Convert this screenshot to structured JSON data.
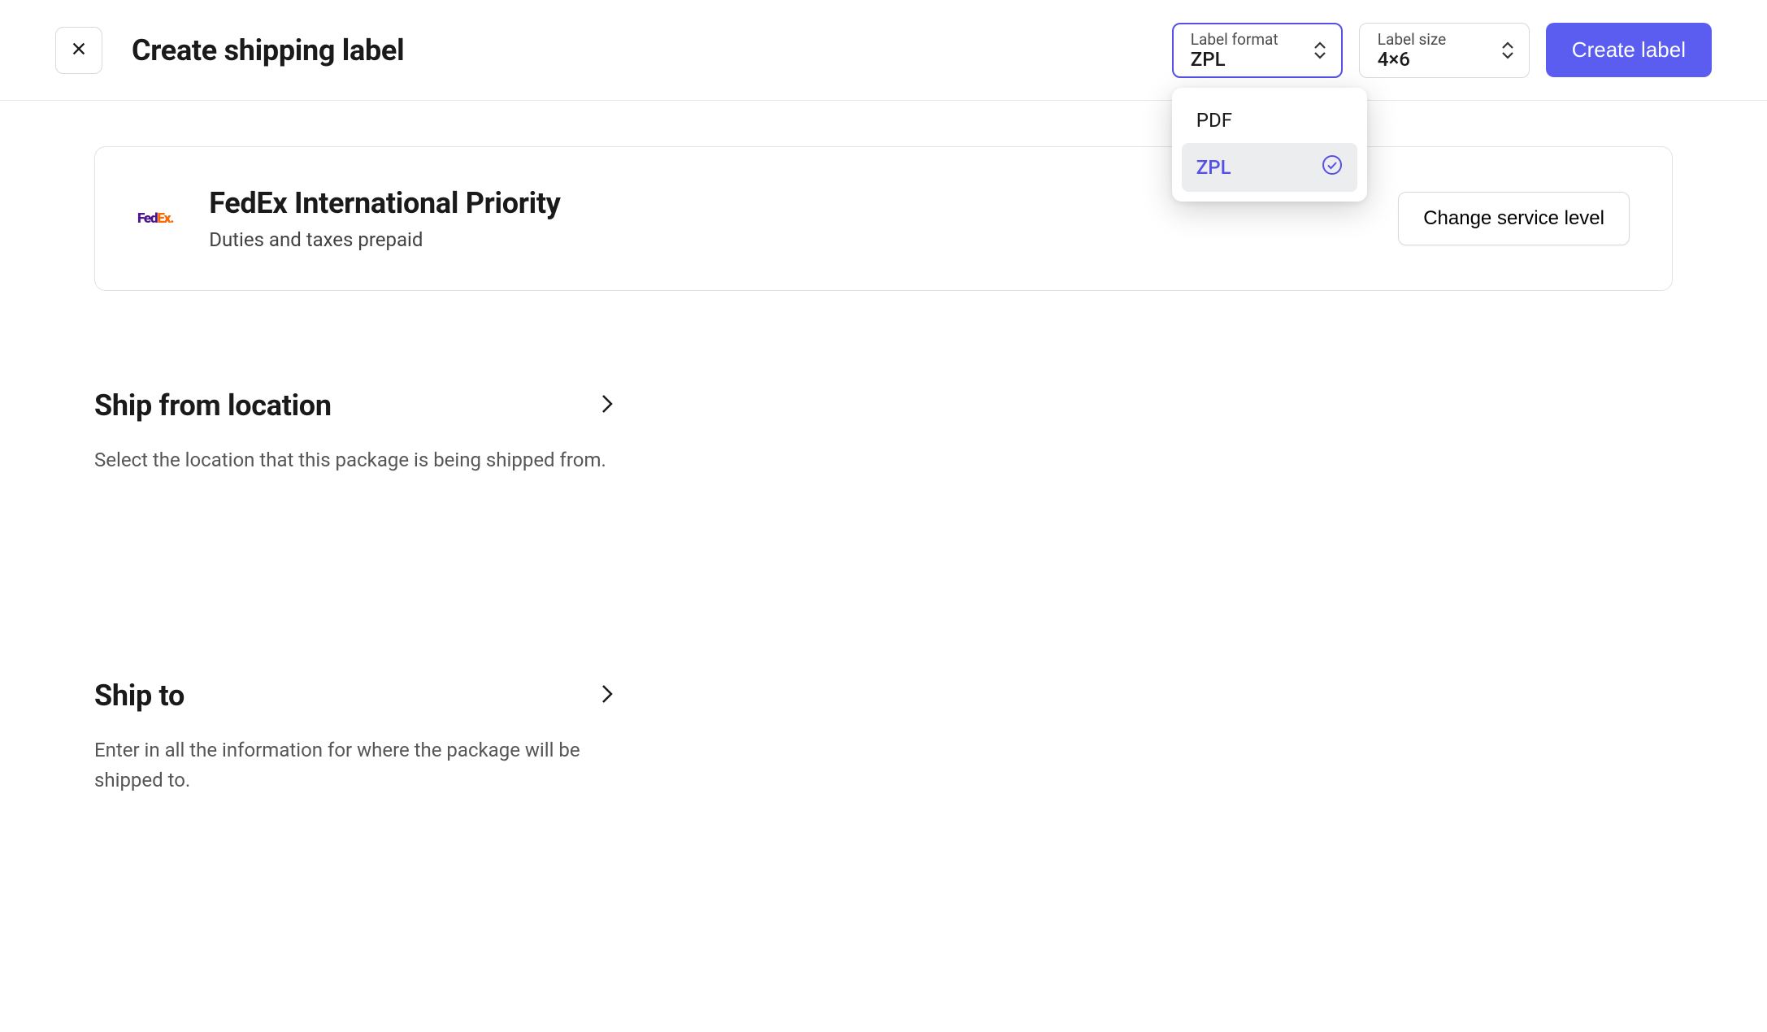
{
  "header": {
    "title": "Create shipping label",
    "label_format": {
      "label": "Label format",
      "value": "ZPL",
      "open": true,
      "options": [
        {
          "label": "PDF",
          "selected": false
        },
        {
          "label": "ZPL",
          "selected": true
        }
      ]
    },
    "label_size": {
      "label": "Label size",
      "value": "4×6"
    },
    "create_button": "Create label"
  },
  "service": {
    "carrier_logo": "FedEx",
    "name": "FedEx International Priority",
    "subtitle": "Duties and taxes prepaid",
    "change_button": "Change service level"
  },
  "sections": {
    "ship_from": {
      "title": "Ship from location",
      "description": "Select the location that this package is being shipped from."
    },
    "ship_to": {
      "title": "Ship to",
      "description": "Enter in all the information for where the package will be shipped to."
    }
  }
}
